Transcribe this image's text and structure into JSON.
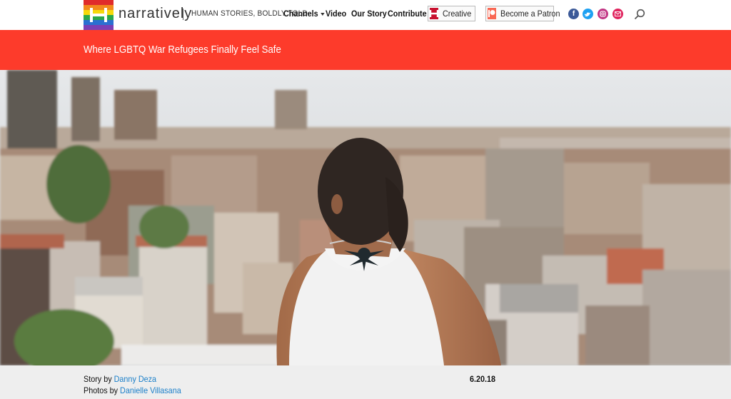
{
  "header": {
    "brand": "narratively",
    "tagline": "HUMAN STORIES, BOLDLY TOLD",
    "nav": [
      {
        "label": "Channels"
      },
      {
        "label": "Video"
      },
      {
        "label": "Our Story"
      },
      {
        "label": "Contribute"
      }
    ],
    "creative_label": "Creative",
    "patron_label": "Become a Patron",
    "social": [
      "facebook-icon",
      "twitter-icon",
      "instagram-icon",
      "email-icon"
    ],
    "colors": {
      "accent": "#fd3b2b",
      "facebook": "#3b5998",
      "twitter": "#1da1f2",
      "instagram": "#c13584",
      "email": "#e0245e"
    }
  },
  "article": {
    "title": "Where LGBTQ War Refugees Finally Feel Safe",
    "story_prefix": "Story by",
    "story_author": "Danny Deza",
    "photos_prefix": "Photos by",
    "photos_author": "Danielle Villasana",
    "date": "6.20.18"
  }
}
